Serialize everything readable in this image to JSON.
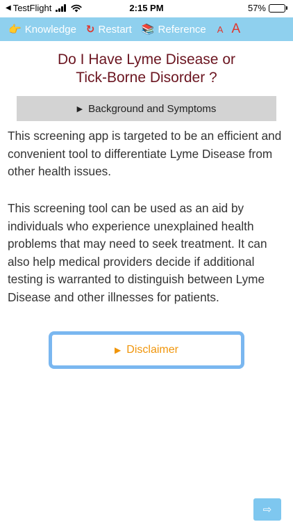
{
  "status_bar": {
    "back_app": "TestFlight",
    "time": "2:15 PM",
    "battery_percent": "57%",
    "battery_level": 0.57
  },
  "toolbar": {
    "knowledge_label": "Knowledge",
    "restart_label": "Restart",
    "reference_label": "Reference",
    "font_small_label": "A",
    "font_large_label": "A"
  },
  "page": {
    "title_line1": "Do I Have Lyme Disease or",
    "title_line2": "Tick-Borne Disorder ?",
    "accordion_label": "Background and Symptoms",
    "paragraph_1": "This screening app is targeted to be an efficient and convenient tool to differentiate Lyme Disease from other health issues.",
    "paragraph_2": "This screening tool can be used as an aid by individuals who experience unexplained health problems that may need to seek treatment. It can also help medical providers decide if additional testing is warranted to distinguish between Lyme Disease and other illnesses for patients.",
    "disclaimer_label": "Disclaimer"
  },
  "icons": {
    "knowledge": "pointing-hand-icon",
    "restart": "restart-icon",
    "reference": "books-icon",
    "next": "next-arrow-icon"
  },
  "colors": {
    "toolbar_bg": "#8fd0ee",
    "title": "#6b1520",
    "accordion_bg": "#d3d3d3",
    "disclaimer_border": "#7ab7f0",
    "disclaimer_text": "#f0950a",
    "font_size_controls": "#e0352b"
  }
}
